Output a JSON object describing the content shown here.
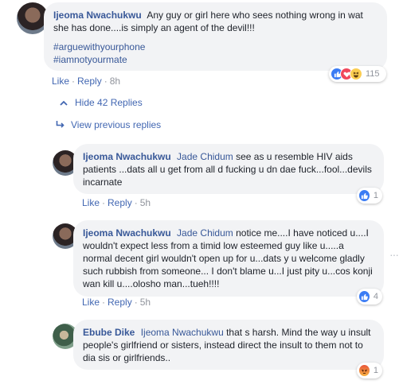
{
  "top_comment": {
    "author": "Ijeoma Nwachukwu",
    "text": "Any guy or girl here who sees nothing wrong in wat she has done....is simply an agent of the devil!!!",
    "hashtags": [
      "#arguewithyourphone",
      "#iamnotyourmate"
    ],
    "like_label": "Like",
    "reply_label": "Reply",
    "time": "8h",
    "reaction_icons": [
      "like-icon",
      "love-icon",
      "haha-icon"
    ],
    "reaction_count": "115"
  },
  "hide_replies_label": "Hide 42 Replies",
  "view_previous_label": "View previous replies",
  "replies": [
    {
      "author": "Ijeoma Nwachukwu",
      "mention": "Jade Chidum",
      "text": "see as u resemble HIV aids patients ...dats all u get from all d fucking u dn dae fuck...fool...devils incarnate",
      "like_label": "Like",
      "reply_label": "Reply",
      "time": "5h",
      "reaction_icons": [
        "like-icon"
      ],
      "reaction_count": "1"
    },
    {
      "author": "Ijeoma Nwachukwu",
      "mention": "Jade Chidum",
      "text": "notice me....I have noticed u....I wouldn't expect less from a timid low esteemed guy like u.....a normal decent girl wouldn't open up for u...dats y u welcome gladly such rubbish from someone... I don't blame u...I just pity u...cos konji wan kill u....olosho man...tueh!!!!",
      "like_label": "Like",
      "reply_label": "Reply",
      "time": "5h",
      "reaction_icons": [
        "like-icon"
      ],
      "reaction_count": "4"
    },
    {
      "author": "Ebube Dike",
      "mention": "Ijeoma Nwachukwu",
      "text": "that s harsh. Mind the way u insult people's girlfriend or sisters, instead direct the insult to them not to dia sis or girlfriends..",
      "reaction_icons": [
        "angry-icon"
      ],
      "reaction_count": "1"
    }
  ]
}
